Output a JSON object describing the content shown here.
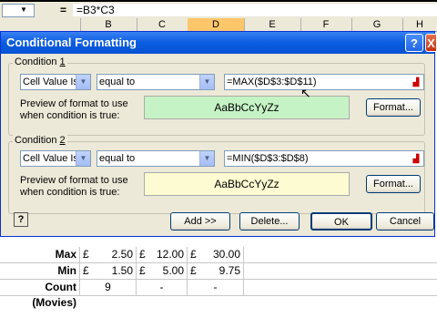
{
  "formula_bar": {
    "name_box": "",
    "equals": "=",
    "formula": "=B3*C3"
  },
  "columns": [
    "B",
    "C",
    "D",
    "E",
    "F",
    "G",
    "H"
  ],
  "selected_column": "D",
  "sheet_rows": [
    {
      "label": "Max",
      "cur1": "£",
      "v1": "2.50",
      "cur2": "£",
      "v2": "12.00",
      "cur3": "£",
      "v3": "30.00"
    },
    {
      "label": "Min",
      "cur1": "£",
      "v1": "1.50",
      "cur2": "£",
      "v2": "5.00",
      "cur3": "£",
      "v3": "9.75"
    },
    {
      "label": "Count (Movies)",
      "cur1": "",
      "v1": "9",
      "cur2": "",
      "v2": "-",
      "cur3": "",
      "v3": "-"
    }
  ],
  "dialog": {
    "title": "Conditional Formatting",
    "help_button": "?",
    "close_button": "X",
    "condition1": {
      "label_prefix": "Condition ",
      "label_num": "1",
      "type": "Cell Value Is",
      "operator": "equal to",
      "formula": "=MAX($D$3:$D$11)",
      "preview_caption_1": "Preview of format to use",
      "preview_caption_2": "when condition is true:",
      "preview_sample": "AaBbCcYyZz",
      "preview_color": "#c6f3c6",
      "format_button": "Format..."
    },
    "condition2": {
      "label_prefix": "Condition ",
      "label_num": "2",
      "type": "Cell Value Is",
      "operator": "equal to",
      "formula": "=MIN($D$3:$D$8)",
      "preview_caption_1": "Preview of format to use",
      "preview_caption_2": "when condition is true:",
      "preview_sample": "AaBbCcYyZz",
      "preview_color": "#fdfbd2",
      "format_button": "Format..."
    },
    "add_button": "Add >>",
    "delete_button": "Delete...",
    "ok_button": "OK",
    "cancel_button": "Cancel"
  }
}
